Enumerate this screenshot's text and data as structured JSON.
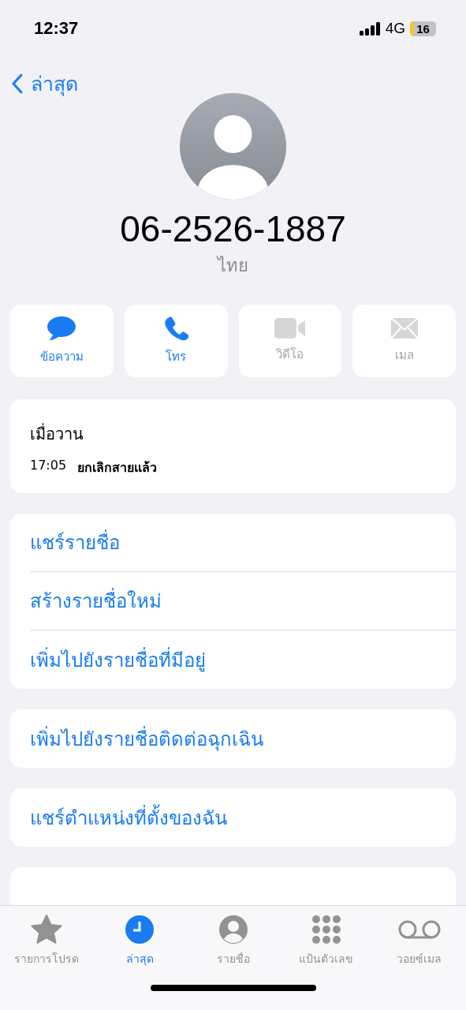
{
  "status_bar": {
    "time": "12:37",
    "network": "4G",
    "battery": "16"
  },
  "nav": {
    "back_label": "ล่าสุด"
  },
  "contact": {
    "number": "06-2526-1887",
    "region": "ไทย"
  },
  "actions": [
    {
      "kind": "message",
      "label": "ข้อความ",
      "disabled": false
    },
    {
      "kind": "call",
      "label": "โทร",
      "disabled": false
    },
    {
      "kind": "video",
      "label": "วิดีโอ",
      "disabled": true
    },
    {
      "kind": "mail",
      "label": "เมล",
      "disabled": true
    }
  ],
  "call_log": {
    "date": "เมื่อวาน",
    "entries": [
      {
        "time": "17:05",
        "status": "ยกเลิกสายแล้ว"
      }
    ]
  },
  "option_groups": [
    [
      "แชร์รายชื่อ",
      "สร้างรายชื่อใหม่",
      "เพิ่มไปยังรายชื่อที่มีอยู่"
    ],
    [
      "เพิ่มไปยังรายชื่อติดต่อฉุกเฉิน"
    ],
    [
      "แชร์ตำแหน่งที่ตั้งของฉัน"
    ]
  ],
  "tabs": [
    {
      "kind": "favorites",
      "label": "รายการโปรด",
      "selected": false
    },
    {
      "kind": "recents",
      "label": "ล่าสุด",
      "selected": true
    },
    {
      "kind": "contacts",
      "label": "รายชื่อ",
      "selected": false
    },
    {
      "kind": "keypad",
      "label": "แป้นตัวเลข",
      "selected": false
    },
    {
      "kind": "voicemail",
      "label": "วอยซ์เมล",
      "selected": false
    }
  ]
}
